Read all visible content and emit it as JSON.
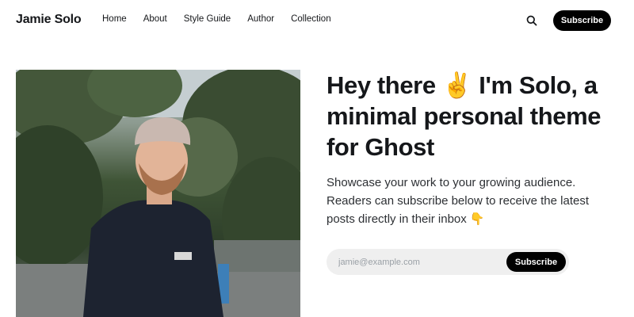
{
  "site": {
    "brand": "Jamie Solo"
  },
  "nav": {
    "items": [
      {
        "label": "Home"
      },
      {
        "label": "About"
      },
      {
        "label": "Style Guide"
      },
      {
        "label": "Author"
      },
      {
        "label": "Collection"
      }
    ],
    "search_icon": "search-icon",
    "subscribe_label": "Subscribe"
  },
  "hero": {
    "title": "Hey there ✌️ I'm Solo, a minimal personal theme for Ghost",
    "description": "Showcase your work to your growing audience. Readers can subscribe below to receive the latest posts directly in their inbox 👇",
    "email_placeholder": "jamie@example.com",
    "subscribe_label": "Subscribe"
  },
  "colors": {
    "accent": "#000000",
    "text": "#15171a",
    "input_bg": "#efefef"
  }
}
